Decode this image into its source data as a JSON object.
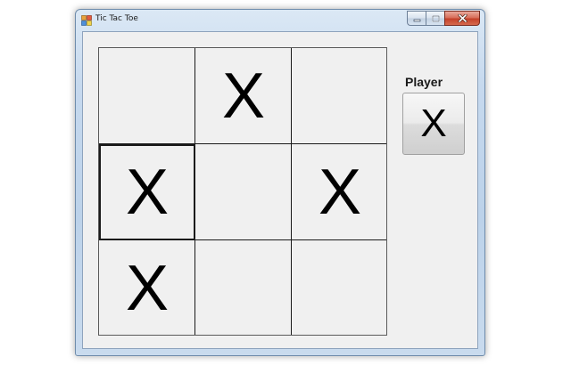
{
  "window": {
    "title": "Tic Tac Toe",
    "icon": "app-window-icon",
    "buttons": {
      "minimize": "minimize-icon",
      "maximize": "maximize-icon",
      "close": "close-icon"
    }
  },
  "board": {
    "cells": [
      {
        "row": 1,
        "col": 1,
        "mark": ""
      },
      {
        "row": 1,
        "col": 2,
        "mark": "X"
      },
      {
        "row": 1,
        "col": 3,
        "mark": ""
      },
      {
        "row": 2,
        "col": 1,
        "mark": "X"
      },
      {
        "row": 2,
        "col": 2,
        "mark": ""
      },
      {
        "row": 2,
        "col": 3,
        "mark": "X"
      },
      {
        "row": 3,
        "col": 1,
        "mark": "X"
      },
      {
        "row": 3,
        "col": 2,
        "mark": ""
      },
      {
        "row": 3,
        "col": 3,
        "mark": ""
      }
    ],
    "selected_cell": {
      "row": 2,
      "col": 1
    }
  },
  "player": {
    "label": "Player",
    "current": "X"
  },
  "colors": {
    "client_background": "#f0f0f0",
    "grid_line": "#1a1a1a",
    "mark": "#000000",
    "close_button": "#c4412a"
  }
}
